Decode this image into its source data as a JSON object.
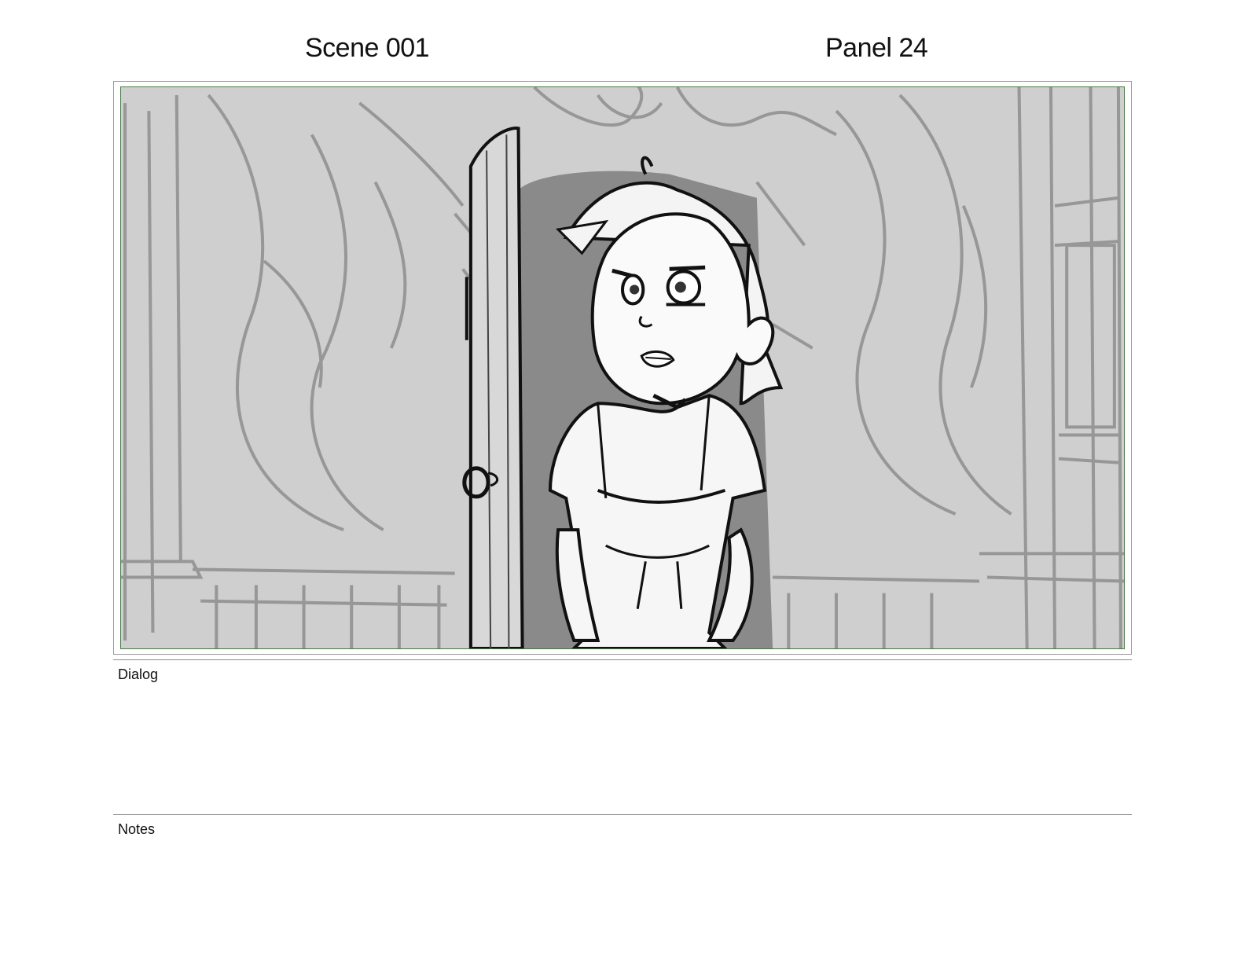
{
  "header": {
    "scene_label": "Scene 001",
    "panel_label": "Panel 24"
  },
  "panel": {
    "safe_area_color": "#2e8b2e",
    "frame_border_color": "#9a9a9a"
  },
  "dialog": {
    "label": "Dialog",
    "text": ""
  },
  "notes": {
    "label": "Notes",
    "text": ""
  }
}
